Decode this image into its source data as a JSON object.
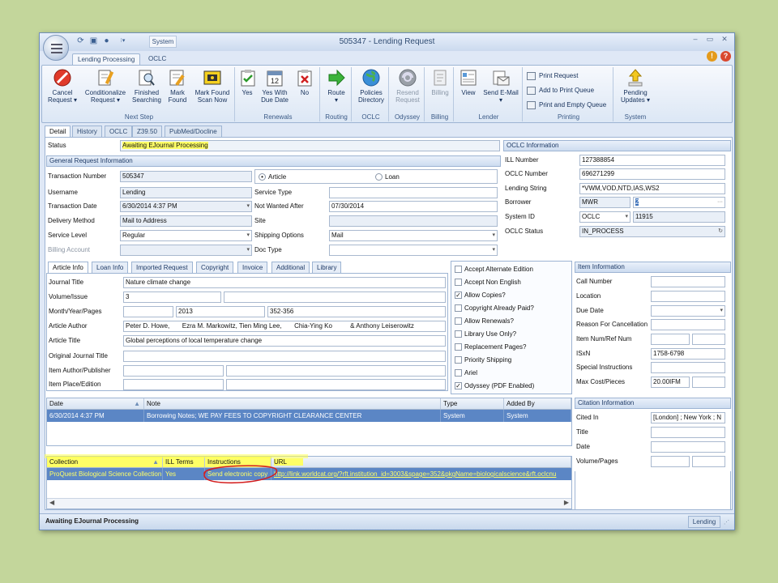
{
  "window": {
    "title": "505347 - Lending Request",
    "system_menu": "System",
    "ribbon_tabs": [
      "Lending Processing",
      "OCLC"
    ]
  },
  "ribbon": {
    "groups": {
      "next_step": "Next Step",
      "renewals": "Renewals",
      "routing": "Routing",
      "oclc": "OCLC",
      "odyssey": "Odyssey",
      "billing": "Billing",
      "lender": "Lender",
      "printing": "Printing",
      "system": "System"
    },
    "buttons": {
      "cancel_request_1": "Cancel",
      "cancel_request_2": "Request ▾",
      "conditionalize_1": "Conditionalize",
      "conditionalize_2": "Request ▾",
      "finished_searching_1": "Finished",
      "finished_searching_2": "Searching",
      "mark_found_1": "Mark",
      "mark_found_2": "Found",
      "mark_found_scan_1": "Mark Found",
      "mark_found_scan_2": "Scan Now",
      "yes": "Yes",
      "yes_with_due_date_1": "Yes With",
      "yes_with_due_date_2": "Due Date",
      "no": "No",
      "route_1": "Route",
      "route_2": "▾",
      "policies_directory_1": "Policies",
      "policies_directory_2": "Directory",
      "resend_request_1": "Resend",
      "resend_request_2": "Request",
      "billing": "Billing",
      "view": "View",
      "send_email_1": "Send E-Mail",
      "send_email_2": "▾",
      "print_request": "Print Request",
      "add_to_print_queue": "Add to Print Queue",
      "print_and_empty_queue": "Print and Empty Queue",
      "pending_updates_1": "Pending",
      "pending_updates_2": "Updates ▾"
    },
    "calendar_day": "12"
  },
  "detail_tabs": [
    "Detail",
    "History",
    "OCLC",
    "Z39.50",
    "PubMed/Docline"
  ],
  "status": {
    "label": "Status",
    "value": "Awaiting EJournal Processing"
  },
  "general": {
    "title": "General Request Information",
    "transaction_number_label": "Transaction Number",
    "transaction_number": "505347",
    "article_radio": "Article",
    "loan_radio": "Loan",
    "username_label": "Username",
    "username": "Lending",
    "service_type_label": "Service Type",
    "service_type": "",
    "transaction_date_label": "Transaction Date",
    "transaction_date": "6/30/2014 4:37 PM",
    "not_wanted_after_label": "Not Wanted After",
    "not_wanted_after": "07/30/2014",
    "delivery_method_label": "Delivery Method",
    "delivery_method": "Mail to Address",
    "site_label": "Site",
    "site": "",
    "service_level_label": "Service Level",
    "service_level": "Regular",
    "shipping_options_label": "Shipping Options",
    "shipping_options": "Mail",
    "billing_account_label": "Billing Account",
    "billing_account": "",
    "doc_type_label": "Doc Type",
    "doc_type": ""
  },
  "oclc_info": {
    "title": "OCLC Information",
    "ill_number_label": "ILL Number",
    "ill_number": "127388854",
    "oclc_number_label": "OCLC Number",
    "oclc_number": "696271299",
    "lending_string_label": "Lending String",
    "lending_string": "*VWM,VOD,NTD,IAS,WS2",
    "borrower_label": "Borrower",
    "borrower": "MWR",
    "borrower_extra": "2",
    "system_id_label": "System ID",
    "system_id": "OCLC",
    "system_id_extra": "11915",
    "oclc_status_label": "OCLC Status",
    "oclc_status": "IN_PROCESS"
  },
  "article_tabs": [
    "Article Info",
    "Loan Info",
    "Imported Request",
    "Copyright",
    "Invoice",
    "Additional",
    "Library"
  ],
  "article": {
    "journal_title_label": "Journal Title",
    "journal_title": "Nature climate change",
    "volume_issue_label": "Volume/Issue",
    "volume": "3",
    "issue": "",
    "month_year_pages_label": "Month/Year/Pages",
    "month": "",
    "year": "2013",
    "pages": "352-356",
    "author_label": "Article Author",
    "author": "Peter D. Howe,       Ezra M. Markowitz, Tien Ming Lee,       Chia-Ying Ko          & Anthony Leiserowitz",
    "article_title_label": "Article Title",
    "article_title": "Global perceptions of local temperature change",
    "original_journal_title_label": "Original Journal Title",
    "item_author_publisher_label": "Item Author/Publisher",
    "item_place_edition_label": "Item Place/Edition"
  },
  "checkboxes": [
    {
      "label": "Accept Alternate Edition",
      "checked": ""
    },
    {
      "label": "Accept Non English",
      "checked": ""
    },
    {
      "label": "Allow Copies?",
      "checked": "✓"
    },
    {
      "label": "Copyright Already Paid?",
      "checked": ""
    },
    {
      "label": "Allow Renewals?",
      "checked": ""
    },
    {
      "label": "Library Use Only?",
      "checked": ""
    },
    {
      "label": "Replacement Pages?",
      "checked": ""
    },
    {
      "label": "Priority Shipping",
      "checked": ""
    },
    {
      "label": "Ariel",
      "checked": ""
    },
    {
      "label": "Odyssey (PDF Enabled)",
      "checked": "✓"
    }
  ],
  "item_info": {
    "title": "Item Information",
    "call_number_label": "Call Number",
    "location_label": "Location",
    "due_date_label": "Due Date",
    "reason_label": "Reason For Cancellation",
    "item_num_label": "Item Num/Ref Num",
    "isxn_label": "ISxN",
    "isxn": "1758-6798",
    "special_label": "Special Instructions",
    "max_cost_label": "Max Cost/Pieces",
    "max_cost": "20.00IFM"
  },
  "notes": {
    "headers": [
      "Date",
      "Note",
      "Type",
      "Added By"
    ],
    "rows": [
      {
        "date": "6/30/2014 4:37 PM",
        "note": "Borrowing Notes; WE PAY FEES TO COPYRIGHT CLEARANCE CENTER",
        "type": "System",
        "added_by": "System"
      }
    ]
  },
  "citation": {
    "title": "Citation Information",
    "cited_in_label": "Cited In",
    "cited_in": "[London] ; New York ; N",
    "title_label": "Title",
    "date_label": "Date",
    "volume_pages_label": "Volume/Pages"
  },
  "collections": {
    "headers": [
      "Collection",
      "ILL Terms",
      "Instructions",
      "URL"
    ],
    "rows": [
      {
        "collection": "ProQuest Biological Science Collection",
        "ill_terms": "Yes",
        "instructions": "Send electronic copy",
        "url": "http://link.worldcat.org/?rft.institution_id=3003&spage=352&pkgName=biologicalscience&rft.oclcnu"
      }
    ]
  },
  "statusbar": {
    "text": "Awaiting EJournal Processing",
    "user": "Lending"
  },
  "colors": {
    "highlight": "#ffff66",
    "selection": "#5b86c5",
    "annotation_red": "#d42020"
  }
}
